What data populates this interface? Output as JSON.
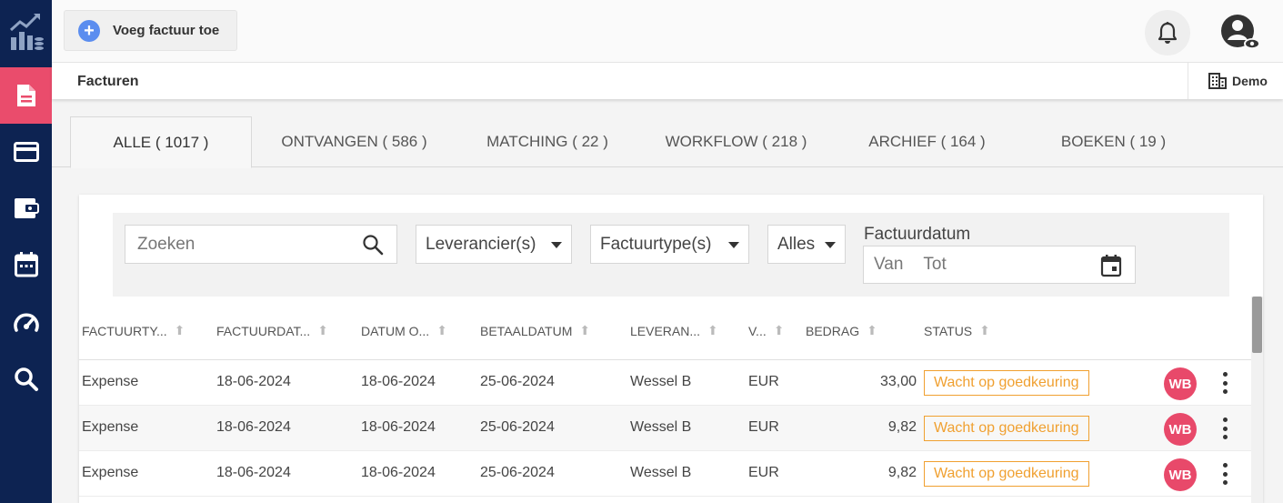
{
  "toolbar": {
    "add_invoice_label": "Voeg factuur toe"
  },
  "header": {
    "page_title": "Facturen",
    "tenant": "Demo"
  },
  "tabs": [
    {
      "label": "ALLE ( 1017 )"
    },
    {
      "label": "ONTVANGEN ( 586 )"
    },
    {
      "label": "MATCHING ( 22 )"
    },
    {
      "label": "WORKFLOW ( 218 )"
    },
    {
      "label": "ARCHIEF ( 164 )"
    },
    {
      "label": "BOEKEN ( 19 )"
    }
  ],
  "filters": {
    "search_placeholder": "Zoeken",
    "supplier": "Leverancier(s)",
    "invoice_type": "Factuurtype(s)",
    "all": "Alles",
    "date_label": "Factuurdatum",
    "date_from": "Van",
    "date_to": "Tot"
  },
  "table": {
    "columns": [
      "FACTUURTY...",
      "FACTUURDAT...",
      "DATUM O...",
      "BETAALDATUM",
      "LEVERAN...",
      "V...",
      "BEDRAG",
      "STATUS"
    ],
    "rows": [
      {
        "type": "Expense",
        "invoice_date": "18-06-2024",
        "date_received": "18-06-2024",
        "pay_date": "25-06-2024",
        "supplier": "Wessel B",
        "currency": "EUR",
        "amount": "33,00",
        "status": "Wacht op goedkeuring",
        "avatar": "WB"
      },
      {
        "type": "Expense",
        "invoice_date": "18-06-2024",
        "date_received": "18-06-2024",
        "pay_date": "25-06-2024",
        "supplier": "Wessel B",
        "currency": "EUR",
        "amount": "9,82",
        "status": "Wacht op goedkeuring",
        "avatar": "WB"
      },
      {
        "type": "Expense",
        "invoice_date": "18-06-2024",
        "date_received": "18-06-2024",
        "pay_date": "25-06-2024",
        "supplier": "Wessel B",
        "currency": "EUR",
        "amount": "9,82",
        "status": "Wacht op goedkeuring",
        "avatar": "WB"
      }
    ]
  },
  "icons": {
    "sidebar": [
      "invoice-icon",
      "credit-card-icon",
      "wallet-icon",
      "calendar-icon",
      "dashboard-icon",
      "search-icon"
    ]
  },
  "colors": {
    "sidebar_bg": "#0d2352",
    "sidebar_active": "#ea4c6c",
    "status_pending": "#f0a030",
    "avatar_bg": "#e8496a",
    "primary_blue": "#5b8def"
  }
}
